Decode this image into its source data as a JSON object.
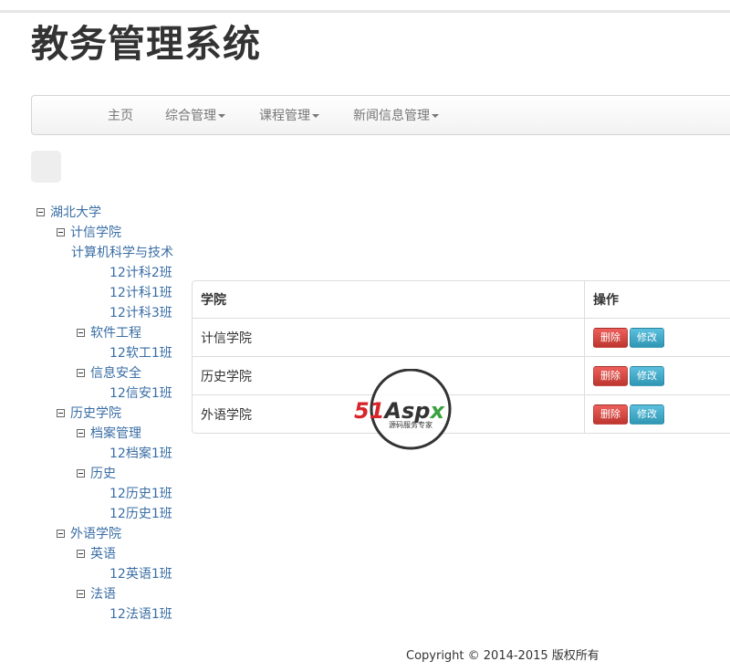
{
  "header": {
    "title": "教务管理系统"
  },
  "nav": {
    "home": "主页",
    "general": "综合管理",
    "course": "课程管理",
    "news": "新闻信息管理"
  },
  "tree": [
    {
      "label": "湖北大学",
      "toggle": true
    },
    {
      "label": "计信学院",
      "toggle": true
    },
    {
      "label": "计算机科学与技术",
      "toggle": false
    },
    {
      "label": "12计科2班",
      "toggle": false
    },
    {
      "label": "12计科1班",
      "toggle": false
    },
    {
      "label": "12计科3班",
      "toggle": false
    },
    {
      "label": "软件工程",
      "toggle": true
    },
    {
      "label": "12软工1班",
      "toggle": false
    },
    {
      "label": "信息安全",
      "toggle": true
    },
    {
      "label": "12信安1班",
      "toggle": false
    },
    {
      "label": "历史学院",
      "toggle": true
    },
    {
      "label": "档案管理",
      "toggle": true
    },
    {
      "label": "12档案1班",
      "toggle": false
    },
    {
      "label": "历史",
      "toggle": true
    },
    {
      "label": "12历史1班",
      "toggle": false
    },
    {
      "label": "12历史1班",
      "toggle": false
    },
    {
      "label": "外语学院",
      "toggle": true
    },
    {
      "label": "英语",
      "toggle": true
    },
    {
      "label": "12英语1班",
      "toggle": false
    },
    {
      "label": "法语",
      "toggle": true
    },
    {
      "label": "12法语1班",
      "toggle": false
    }
  ],
  "table": {
    "headers": [
      "学院",
      "操作"
    ],
    "rows": [
      {
        "college": "计信学院"
      },
      {
        "college": "历史学院"
      },
      {
        "college": "外语学院"
      }
    ],
    "delete_label": "删除",
    "edit_label": "修改"
  },
  "watermark": {
    "brand": "51Aspx",
    "tagline": "源码服务专家"
  },
  "footer": {
    "text": "Copyright © 2014-2015 版权所有"
  },
  "colors": {
    "tree_link": "#3a6ea5",
    "delete_button": "#da4f49",
    "edit_button": "#49afcd",
    "watermark_red": "#d7262b",
    "watermark_green": "#3aa23f"
  }
}
